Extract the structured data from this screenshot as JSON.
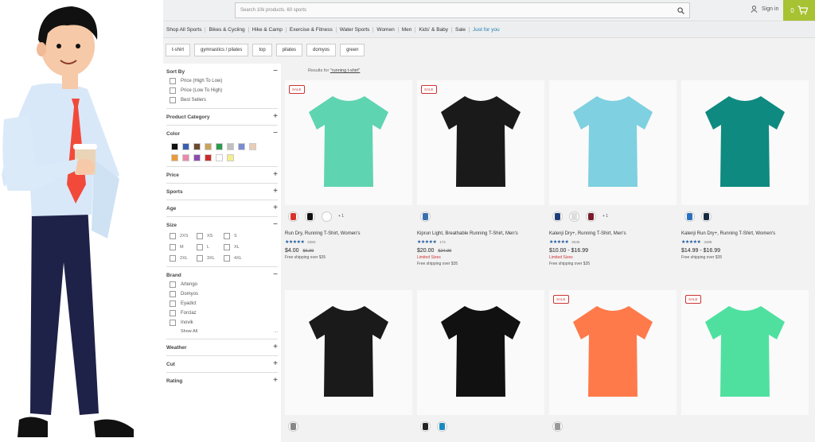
{
  "header": {
    "search_placeholder": "Search 10k products. 60 sports",
    "signin_label": "Sign in",
    "cart_count": "0"
  },
  "nav": [
    "Shop All Sports",
    "Bikes & Cycling",
    "Hike & Camp",
    "Exercise & Fitness",
    "Water Sports",
    "Women",
    "Men",
    "Kids' & Baby",
    "Sale",
    "Just for you"
  ],
  "chips": [
    "t-shirt",
    "gymnastics / pilates",
    "top",
    "pilates",
    "domyos",
    "green"
  ],
  "filters": {
    "sort_by": {
      "title": "Sort By",
      "options": [
        "Price (High To Low)",
        "Price (Low To High)",
        "Best Sellers"
      ]
    },
    "product_category": "Product Category",
    "color": {
      "title": "Color",
      "swatches": [
        "#111111",
        "#3a5fb0",
        "#6b4a2f",
        "#c9a35a",
        "#2e9a4e",
        "#bfbfbf",
        "#7a8dd1",
        "#e9cdb5",
        "#e89b3a",
        "#e88aa8",
        "#8b4bb0",
        "#cc2b2b",
        "#ffffff",
        "#f3ee8f"
      ]
    },
    "price": "Price",
    "sports": "Sports",
    "age": "Age",
    "size": {
      "title": "Size",
      "options": [
        "2XS",
        "XS",
        "S",
        "M",
        "L",
        "XL",
        "2XL",
        "3XL",
        "4XL"
      ]
    },
    "brand": {
      "title": "Brand",
      "options": [
        "Artengo",
        "Domyos",
        "Eyadict",
        "Forclaz",
        "Inovik"
      ],
      "show_all": "Show All",
      "more": "..."
    },
    "weather": "Weather",
    "cut": "Cut",
    "rating": "Rating"
  },
  "results": {
    "prefix": "Results for ",
    "query": "\"running t-shirt\""
  },
  "products": [
    {
      "sale": "SALE",
      "name": "Run Dry, Running T-Shirt, Women's",
      "reviews": "5350",
      "price": "$4.00",
      "old_price": "$6.99",
      "limited": "",
      "shipping": "Free shipping over $35",
      "colors": [
        "#d9302a",
        "#111111",
        "#ffffff"
      ],
      "more": "+ 1",
      "shirt": "#5fd4b1"
    },
    {
      "sale": "SALE",
      "name": "Kiprun Light, Breathable Running T-Shirt, Men's",
      "reviews": "172",
      "price": "$20.00",
      "old_price": "$24.99",
      "limited": "Limited Sizes",
      "shipping": "Free shipping over $35",
      "colors": [
        "#3a6fb0"
      ],
      "more": "",
      "shirt": "#1a1a1a"
    },
    {
      "sale": "",
      "name": "Kalenji Dry+, Running T-Shirt, Men's",
      "reviews": "6045",
      "price": "$10.00 - $16.99",
      "old_price": "",
      "limited": "Limited Sizes",
      "shipping": "Free shipping over $35",
      "colors": [
        "#1f3d7a",
        "#dddddd",
        "#7a1a2a"
      ],
      "more": "+ 1",
      "shirt": "#7fd0e0"
    },
    {
      "sale": "",
      "name": "Kalenji Run Dry+, Running T-Shirt, Women's",
      "reviews": "3499",
      "price": "$14.99 - $16.99",
      "old_price": "",
      "limited": "",
      "shipping": "Free shipping over $35",
      "colors": [
        "#2a6fc0",
        "#1a2a40"
      ],
      "more": "",
      "shirt": "#0e8a80"
    }
  ],
  "products_row2": [
    {
      "sale": "",
      "shirt": "#1a1a1a",
      "colors": [
        "#888888"
      ]
    },
    {
      "sale": "",
      "shirt": "#111111",
      "colors": [
        "#222222",
        "#1a8ac0"
      ]
    },
    {
      "sale": "SALE",
      "shirt": "#ff7a4a",
      "colors": [
        "#999999"
      ]
    },
    {
      "sale": "SALE",
      "shirt": "#4fe0a0",
      "colors": []
    }
  ]
}
